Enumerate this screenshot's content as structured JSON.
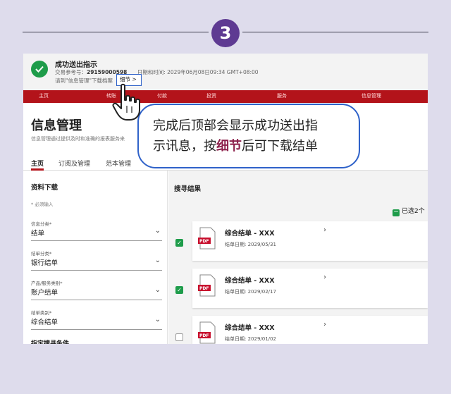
{
  "step": {
    "number": "3"
  },
  "toast": {
    "title": "成功送出指示",
    "ref_label": "交易参考号：",
    "ref_number": "29159000598",
    "datetime": "日期和时间: 2029年06月08日09:34 GMT+08:00",
    "hint": "请到\"信息管理\"下载档案",
    "details_link": "细节 >"
  },
  "nav": {
    "items": [
      "主页",
      "转账",
      "付款",
      "投资",
      "服务",
      "信息管理"
    ]
  },
  "page": {
    "title": "信息管理",
    "subtitle": "信息管理通过提供及时和准确的报表服务来",
    "tabs": [
      "主页",
      "订阅及管理",
      "范本管理"
    ]
  },
  "left_panel": {
    "title": "资料下载",
    "required_note": "* 必须输入",
    "fields": [
      {
        "label": "信息分类*",
        "value": "结单"
      },
      {
        "label": "结单分类*",
        "value": "银行结单"
      },
      {
        "label": "产品/服务类别*",
        "value": "账户结单"
      },
      {
        "label": "结单类别*",
        "value": "综合结单"
      }
    ],
    "more_label": "指定搜寻条件"
  },
  "results": {
    "title": "搜寻结果",
    "selected_count": "已选2个",
    "items": [
      {
        "name": "综合结单 - XXX",
        "date": "结单日期:    2029/05/31",
        "checked": true
      },
      {
        "name": "综合结单 - XXX",
        "date": "结单日期:    2029/02/17",
        "checked": true
      },
      {
        "name": "综合结单 - XXX",
        "date": "结单日期:    2029/01/02",
        "checked": false
      }
    ]
  },
  "callout": {
    "line1": "完成后顶部会显示成功送出指",
    "line2_pre": "示讯息，按",
    "line2_bold": "细节",
    "line2_post": "后可下载结单"
  },
  "colors": {
    "brand_red": "#b3131a",
    "success_green": "#1e9c4a",
    "step_purple": "#5e3a92",
    "highlight_blue": "#2f62c9"
  }
}
